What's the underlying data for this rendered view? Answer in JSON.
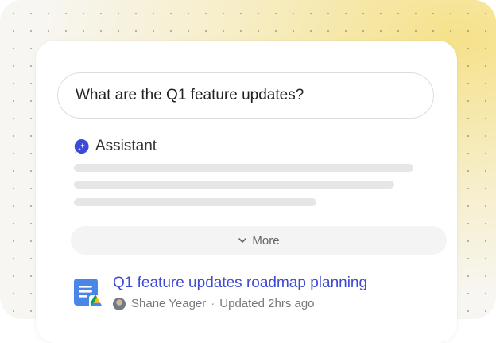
{
  "query": {
    "text": "What are the Q1 feature updates?"
  },
  "assistant": {
    "label": "Assistant",
    "icon": "sparkle-bubble-icon",
    "accent": "#3d4ad6"
  },
  "more": {
    "label": "More",
    "icon": "chevron-down-icon"
  },
  "result": {
    "title": "Q1 feature updates roadmap planning",
    "author": "Shane Yeager",
    "separator": "·",
    "updated": "Updated 2hrs ago",
    "icon": "document-icon",
    "badge": "drive-icon"
  }
}
